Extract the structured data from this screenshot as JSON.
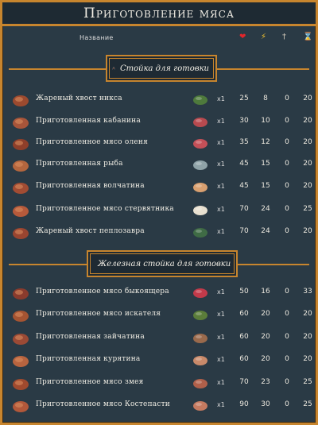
{
  "title": "Приготовление мяса",
  "header": {
    "name_label": "Название",
    "health_icon": "heart-icon",
    "stamina_icon": "lightning-icon",
    "healing_icon": "staff-icon",
    "duration_icon": "hourglass-icon",
    "colors": {
      "heart": "#e0262b",
      "lightning": "#f4c430",
      "hourglass": "#f0d070"
    }
  },
  "sections": [
    {
      "label": "Стойка для готовки",
      "icon": "cooking-station-icon",
      "rows": [
        {
          "name": "Жареный хвост никса",
          "qty": "x1",
          "health": "25",
          "stamina": "8",
          "healing": "0",
          "duration": "20",
          "dish_icon": "cooked-tail-icon",
          "ingredient_icon": "raw-tail-icon"
        },
        {
          "name": "Приготовленная кабанина",
          "qty": "x1",
          "health": "30",
          "stamina": "10",
          "healing": "0",
          "duration": "20",
          "dish_icon": "cooked-meat-icon",
          "ingredient_icon": "raw-meat-icon"
        },
        {
          "name": "Приготовленное мясо оленя",
          "qty": "x1",
          "health": "35",
          "stamina": "12",
          "healing": "0",
          "duration": "20",
          "dish_icon": "cooked-deer-meat-icon",
          "ingredient_icon": "raw-deer-meat-icon"
        },
        {
          "name": "Приготовленная рыба",
          "qty": "x1",
          "health": "45",
          "stamina": "15",
          "healing": "0",
          "duration": "20",
          "dish_icon": "cooked-fish-icon",
          "ingredient_icon": "raw-fish-icon"
        },
        {
          "name": "Приготовленная волчатина",
          "qty": "x1",
          "health": "45",
          "stamina": "15",
          "healing": "0",
          "duration": "20",
          "dish_icon": "cooked-wolf-meat-icon",
          "ingredient_icon": "raw-wolf-meat-icon"
        },
        {
          "name": "Приготовленное мясо стервятника",
          "qty": "x1",
          "health": "70",
          "stamina": "24",
          "healing": "0",
          "duration": "25",
          "dish_icon": "cooked-bird-meat-icon",
          "ingredient_icon": "raw-bird-meat-icon"
        },
        {
          "name": "Жареный хвост пеплозавра",
          "qty": "x1",
          "health": "70",
          "stamina": "24",
          "healing": "0",
          "duration": "20",
          "dish_icon": "cooked-ash-tail-icon",
          "ingredient_icon": "raw-ash-tail-icon"
        }
      ]
    },
    {
      "label": "Железная стойка для готовки",
      "icon": "iron-cooking-station-icon",
      "rows": [
        {
          "name": "Приготовленное мясо быкоящера",
          "qty": "x1",
          "health": "50",
          "stamina": "16",
          "healing": "0",
          "duration": "33",
          "dish_icon": "cooked-lizard-meat-icon",
          "ingredient_icon": "raw-lizard-meat-icon"
        },
        {
          "name": "Приготовленное мясо искателя",
          "qty": "x1",
          "health": "60",
          "stamina": "20",
          "healing": "0",
          "duration": "20",
          "dish_icon": "cooked-seeker-meat-icon",
          "ingredient_icon": "raw-seeker-meat-icon"
        },
        {
          "name": "Приготовленная зайчатина",
          "qty": "x1",
          "health": "60",
          "stamina": "20",
          "healing": "0",
          "duration": "20",
          "dish_icon": "cooked-hare-icon",
          "ingredient_icon": "raw-hare-icon"
        },
        {
          "name": "Приготовленная курятина",
          "qty": "x1",
          "health": "60",
          "stamina": "20",
          "healing": "0",
          "duration": "20",
          "dish_icon": "cooked-chicken-icon",
          "ingredient_icon": "raw-chicken-icon"
        },
        {
          "name": "Приготовленное мясо змея",
          "qty": "x1",
          "health": "70",
          "stamina": "23",
          "healing": "0",
          "duration": "25",
          "dish_icon": "cooked-serpent-meat-icon",
          "ingredient_icon": "raw-serpent-meat-icon"
        },
        {
          "name": "Приготовленное мясо Костепасти",
          "qty": "x1",
          "health": "90",
          "stamina": "30",
          "healing": "0",
          "duration": "25",
          "dish_icon": "cooked-bonemaw-meat-icon",
          "ingredient_icon": "raw-bonemaw-meat-icon"
        }
      ]
    }
  ]
}
